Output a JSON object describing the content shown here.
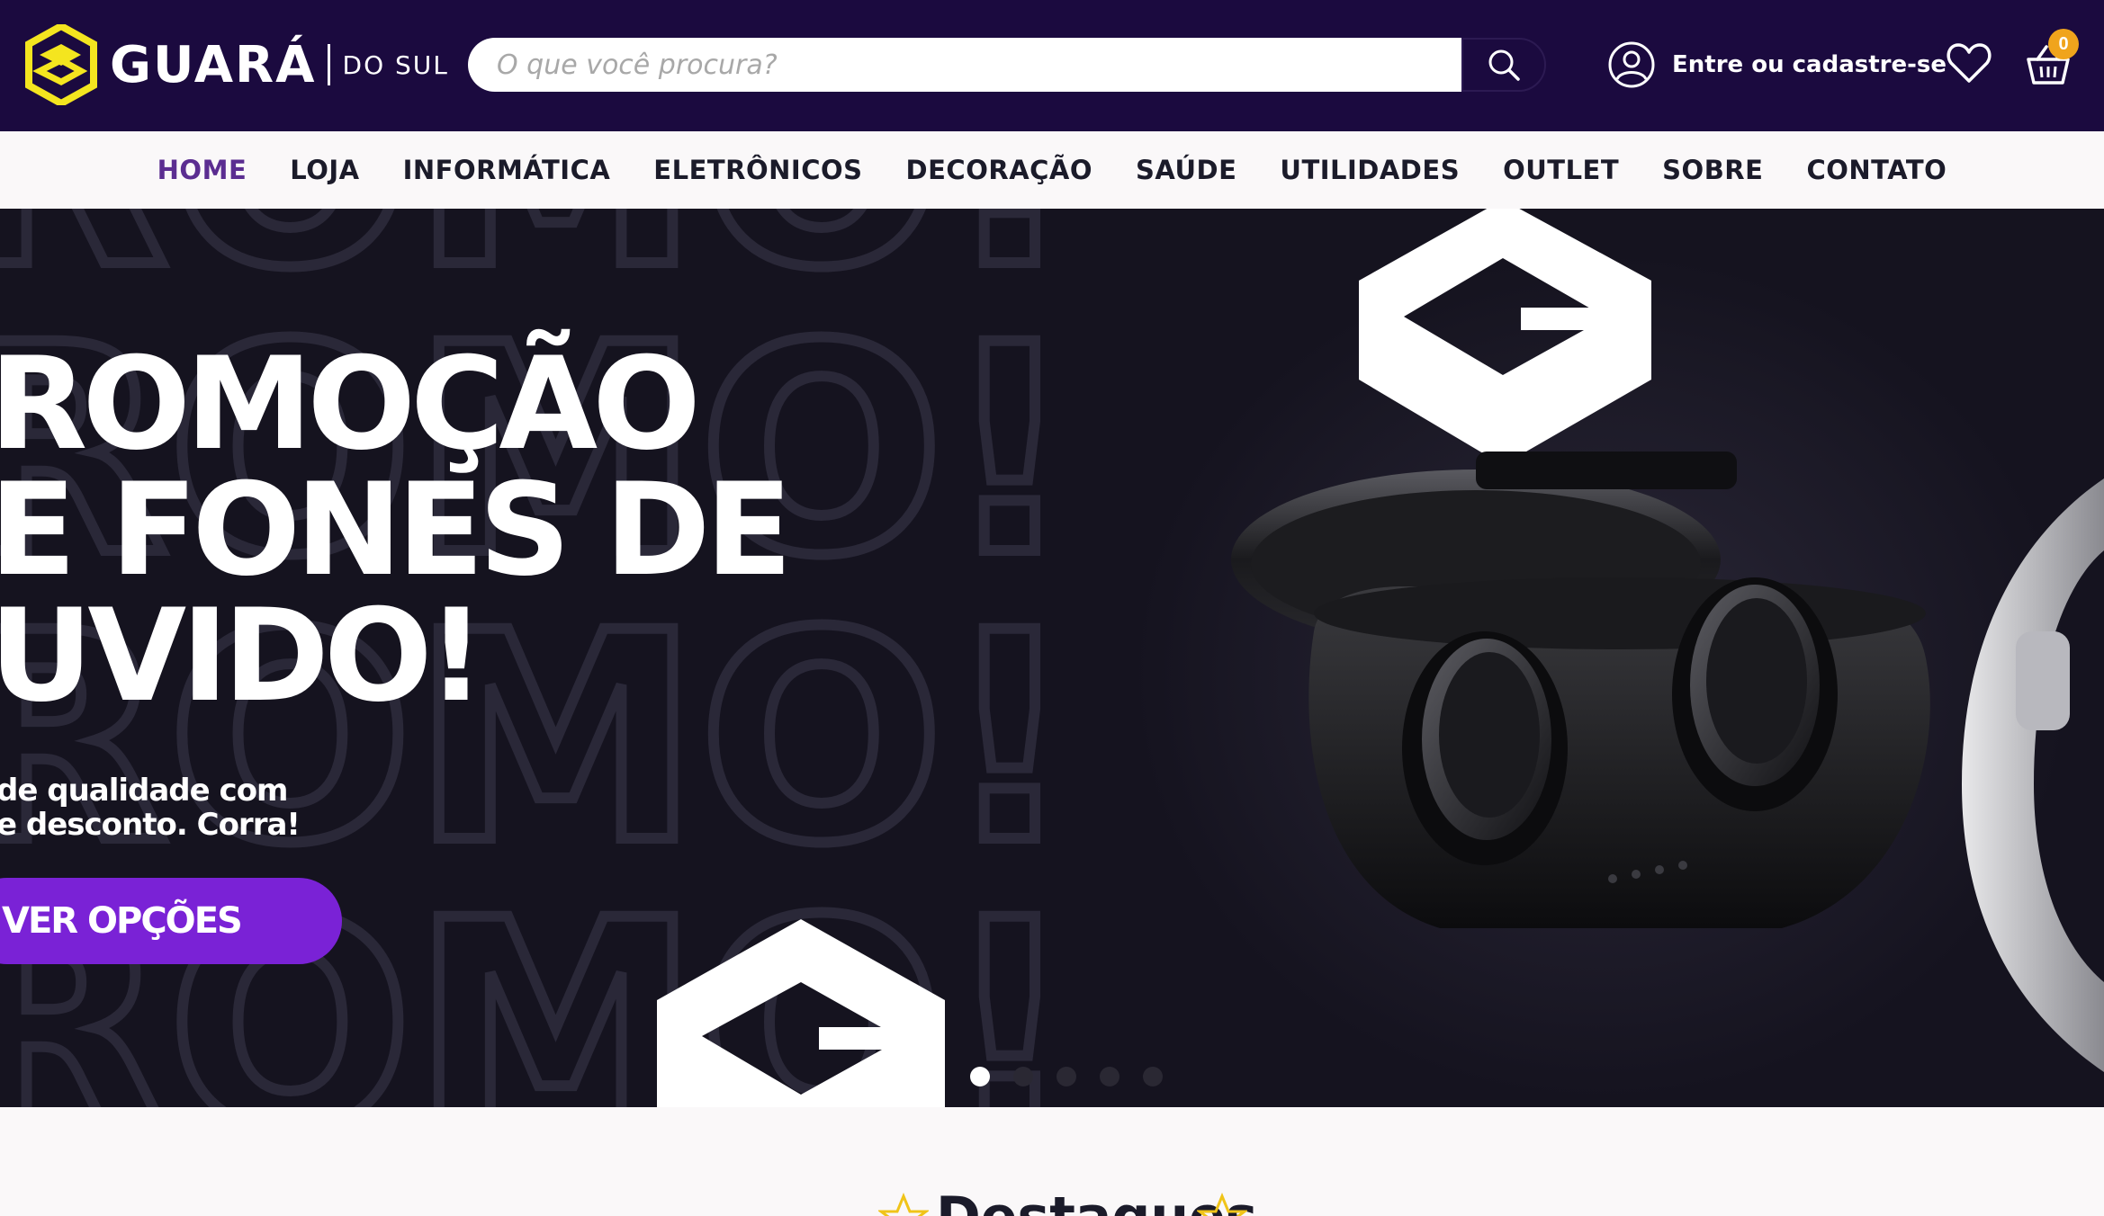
{
  "header": {
    "brand": "GUARÁ",
    "brand_sub": "DO SUL",
    "search_placeholder": "O que você procura?",
    "account_label": "Entre ou cadastre-se",
    "cart_count": "0",
    "icons": [
      "search-icon",
      "user-icon",
      "heart-icon",
      "basket-icon"
    ]
  },
  "nav": {
    "items": [
      "HOME",
      "LOJA",
      "INFORMÁTICA",
      "ELETRÔNICOS",
      "DECORAÇÃO",
      "SAÚDE",
      "UTILIDADES",
      "OUTLET",
      "SOBRE",
      "CONTATO"
    ],
    "active": "HOME"
  },
  "hero": {
    "title_line1": "ROMOÇÃO",
    "title_line2": "E FONES DE",
    "title_line3": "UVIDO!",
    "subtitle_line1": "de qualidade com",
    "subtitle_line2": "e desconto. Corra!",
    "button_label": "VER OPÇÕES",
    "slides_total": 5,
    "active_slide": 1
  },
  "section": {
    "title": "Destaques"
  },
  "colors": {
    "header_bg": "#1b0a3f",
    "accent_purple": "#7a22d6",
    "nav_active": "#5b2d91",
    "logo_yellow": "#f4e51f",
    "badge_orange": "#f0a41c",
    "hero_bg": "#15131f"
  }
}
